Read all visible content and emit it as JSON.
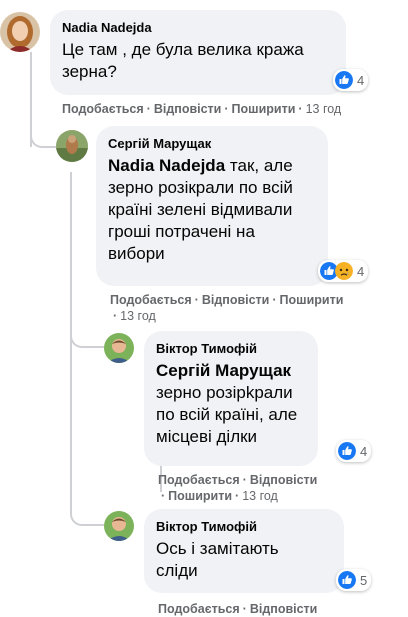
{
  "comments": [
    {
      "author": "Nadia Nadejda",
      "mention": "",
      "text": "Це там , де була велика кража зерна?",
      "reaction_count": "4",
      "like_label": "Подобається",
      "reply_label": "Відповісти",
      "share_label": "Поширити",
      "time": "13 год"
    },
    {
      "author": "Сергій Марущак",
      "mention": "Nadia Nadejda",
      "text": "так, але зерно розікрали по всій країні зелені відмивали гроші потрачені на вибори",
      "reaction_count": "4",
      "like_label": "Подобається",
      "reply_label": "Відповісти",
      "share_label": "Поширити",
      "time": "13 год"
    },
    {
      "author": "Віктор Тимофій",
      "mention": "Сергій Марущак",
      "text": "зерно розірkрали по всій країні, але місцеві ділки",
      "reaction_count": "4",
      "like_label": "Подобається",
      "reply_label": "Відповісти",
      "share_label": "Поширити",
      "time": "13 год"
    },
    {
      "author": "Віктор Тимофій",
      "mention": "",
      "text": "Ось і замітають сліди",
      "reaction_count": "5",
      "like_label": "Подобається",
      "reply_label": "Відповісти"
    }
  ],
  "icons": {
    "like": "like-reaction-icon",
    "sad": "sad-reaction-icon"
  },
  "colors": {
    "like_blue": "#1877f2",
    "sad_yellow": "#f7b125",
    "bubble_bg": "#f0f2f5",
    "meta_gray": "#65676b"
  }
}
